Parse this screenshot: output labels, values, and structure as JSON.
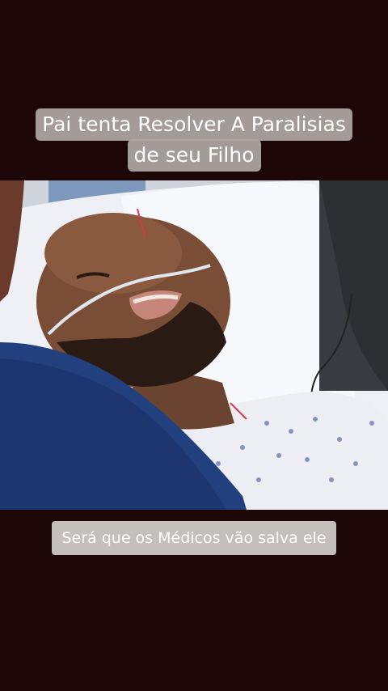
{
  "overlay": {
    "title_line1": "Pai tenta Resolver A Paralisias",
    "title_line2": "de seu Filho",
    "caption": "Será que os Médicos vão salva ele"
  },
  "colors": {
    "background": "#1c0608",
    "title_box": "#b0a8a6",
    "caption_box": "#cec8c6",
    "text": "#ffffff"
  },
  "video": {
    "description_icon": "video-frame"
  }
}
